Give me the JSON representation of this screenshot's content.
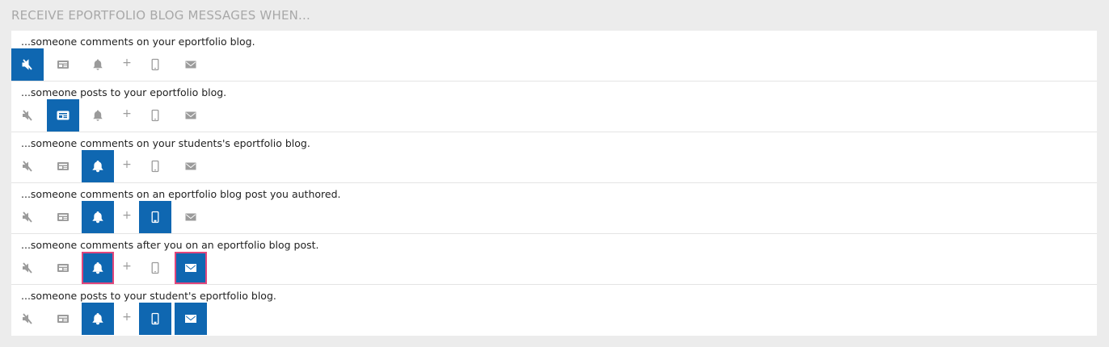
{
  "section_title": "RECEIVE EPORTFOLIO BLOG MESSAGES WHEN...",
  "plus_symbol": "+",
  "icons": [
    "mute-icon",
    "digest-icon",
    "bell-icon",
    "mobile-icon",
    "email-icon"
  ],
  "accent_color": "#0f67b1",
  "focus_color": "#e0457b",
  "rows": [
    {
      "label": "...someone comments on your eportfolio blog.",
      "selected": {
        "mute": true,
        "digest": false,
        "notify": false,
        "mobile": false,
        "email": false
      }
    },
    {
      "label": "...someone posts to your eportfolio blog.",
      "selected": {
        "mute": false,
        "digest": true,
        "notify": false,
        "mobile": false,
        "email": false
      }
    },
    {
      "label": "...someone comments on your students's eportfolio blog.",
      "selected": {
        "mute": false,
        "digest": false,
        "notify": true,
        "mobile": false,
        "email": false
      }
    },
    {
      "label": "...someone comments on an eportfolio blog post you authored.",
      "selected": {
        "mute": false,
        "digest": false,
        "notify": true,
        "mobile": true,
        "email": false
      }
    },
    {
      "label": "...someone comments after you on an eportfolio blog post.",
      "selected": {
        "mute": false,
        "digest": false,
        "notify": true,
        "mobile": false,
        "email": true
      },
      "focused": [
        "notify",
        "email"
      ]
    },
    {
      "label": "...someone posts to your student's eportfolio blog.",
      "selected": {
        "mute": false,
        "digest": false,
        "notify": true,
        "mobile": true,
        "email": true
      }
    }
  ]
}
